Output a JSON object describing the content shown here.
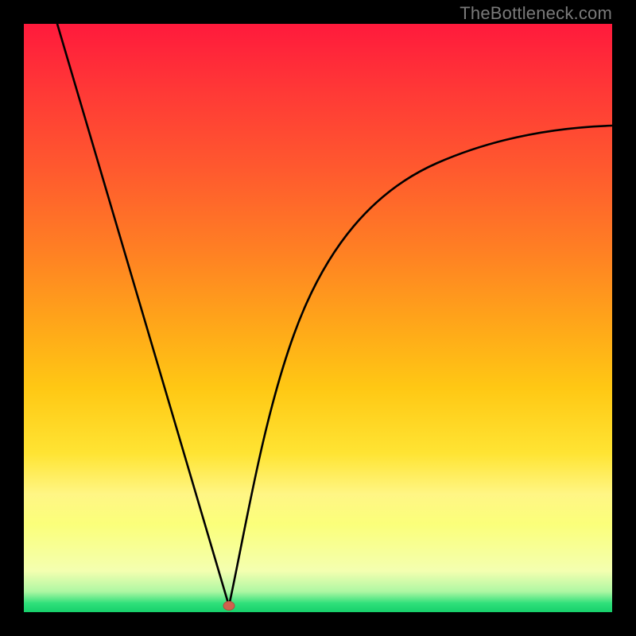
{
  "watermark": {
    "text": "TheBottleneck.com"
  },
  "colors": {
    "background": "#000000",
    "curve_stroke": "#000000",
    "marker_fill": "#d1614e",
    "gradient_top": "#ff1a3c",
    "gradient_bottom": "#17d06b"
  },
  "chart_data": {
    "type": "line",
    "title": "",
    "xlabel": "",
    "ylabel": "",
    "xlim": [
      0,
      100
    ],
    "ylim": [
      0,
      100
    ],
    "grid": false,
    "legend": false,
    "marker": {
      "x": 35,
      "y": 1
    },
    "series": [
      {
        "name": "left-branch",
        "x": [
          6,
          8,
          10,
          12,
          14,
          16,
          18,
          20,
          22,
          24,
          26,
          28,
          30,
          32,
          34,
          35
        ],
        "values": [
          100,
          93,
          86,
          79,
          72,
          65,
          59,
          52,
          45,
          38,
          31,
          25,
          18,
          11,
          4,
          1
        ]
      },
      {
        "name": "right-branch",
        "x": [
          35,
          37,
          39,
          42,
          45,
          48,
          52,
          56,
          60,
          65,
          70,
          75,
          80,
          85,
          90,
          95,
          100
        ],
        "values": [
          1,
          8,
          16,
          25,
          33,
          40,
          47,
          53,
          58,
          63,
          67,
          71,
          74,
          76.5,
          78.7,
          80.5,
          82
        ]
      }
    ]
  }
}
